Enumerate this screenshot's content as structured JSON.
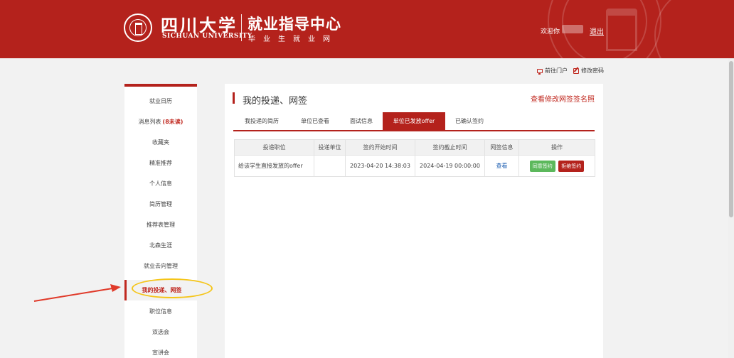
{
  "header": {
    "brand_cn": "四川大学",
    "brand_en": "SICHUAN UNIVERSITY",
    "site_title": "就业指导中心",
    "site_subtitle": "毕业生就业网",
    "welcome": "欢迎你",
    "logout": "退出"
  },
  "toplinks": {
    "portal": "前往门户",
    "change_password": "修改密码"
  },
  "sidebar": {
    "items": [
      {
        "label": "就业日历",
        "badge": ""
      },
      {
        "label": "消息列表",
        "badge": "(8未读)"
      },
      {
        "label": "收藏夹",
        "badge": ""
      },
      {
        "label": "精准推荐",
        "badge": ""
      },
      {
        "label": "个人信息",
        "badge": ""
      },
      {
        "label": "简历管理",
        "badge": ""
      },
      {
        "label": "推荐表管理",
        "badge": ""
      },
      {
        "label": "北森生涯",
        "badge": ""
      },
      {
        "label": "就业去向管理",
        "badge": ""
      },
      {
        "label": "我的投递、网签",
        "badge": ""
      },
      {
        "label": "职位信息",
        "badge": ""
      },
      {
        "label": "双选会",
        "badge": ""
      },
      {
        "label": "宣讲会",
        "badge": ""
      }
    ],
    "active_index": 9
  },
  "main": {
    "title": "我的投递、网签",
    "top_link": "查看修改网签签名照",
    "tabs": [
      {
        "label": "我投递的简历"
      },
      {
        "label": "单位已查看"
      },
      {
        "label": "面试信息"
      },
      {
        "label": "单位已发放offer"
      },
      {
        "label": "已确认签约"
      }
    ],
    "active_tab": 3,
    "table": {
      "headers": [
        "投递职位",
        "投递单位",
        "签约开始时间",
        "签约截止时间",
        "网签信息",
        "操作"
      ],
      "rows": [
        {
          "position": "给该学生直接发放的offer",
          "company": "",
          "start": "2023-04-20 14:38:03",
          "end": "2024-04-19 00:00:00",
          "info": "查看",
          "agree": "同意签约",
          "reject": "拒绝签约"
        }
      ]
    }
  },
  "colors": {
    "brand_red": "#b4221c",
    "accent_red": "#c0281f",
    "green": "#5cb85c",
    "link_blue": "#1a5cb0",
    "annotation_yellow": "#f5c518",
    "annotation_arrow": "#e03a2a"
  }
}
